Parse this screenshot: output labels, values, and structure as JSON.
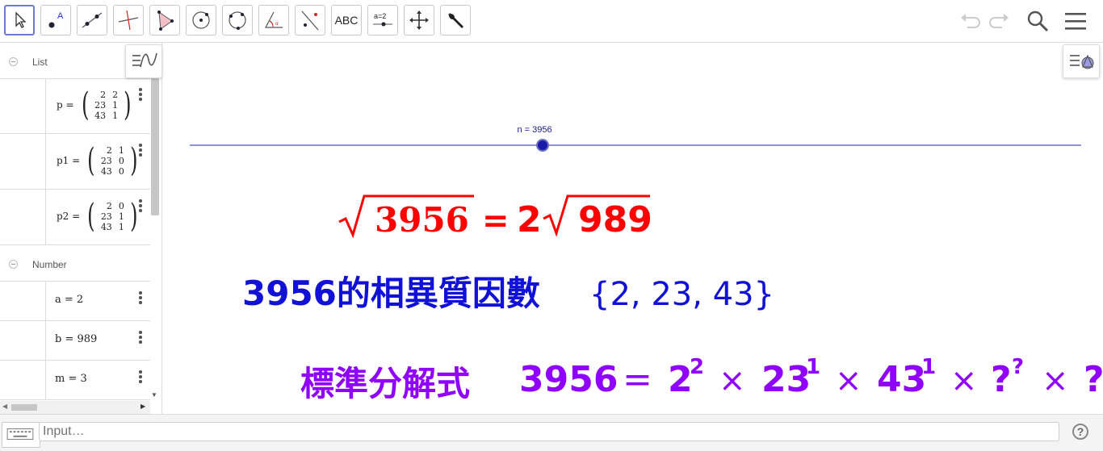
{
  "toolbar": {
    "tools": [
      {
        "id": "move",
        "active": true
      },
      {
        "id": "point"
      },
      {
        "id": "line"
      },
      {
        "id": "perpendicular-line"
      },
      {
        "id": "polygon"
      },
      {
        "id": "circle-center-point"
      },
      {
        "id": "circle-three-points"
      },
      {
        "id": "angle"
      },
      {
        "id": "reflect"
      },
      {
        "id": "text",
        "label": "ABC"
      },
      {
        "id": "slider",
        "label": "a=2"
      },
      {
        "id": "move-graphics-view"
      },
      {
        "id": "tools-wrench"
      }
    ],
    "right": [
      "undo-icon",
      "redo-icon",
      "search-icon",
      "menu-icon"
    ]
  },
  "algebra": {
    "list_group": "List",
    "number_group": "Number",
    "matrices": [
      {
        "name": "p",
        "rows": [
          [
            "2",
            "2"
          ],
          [
            "23",
            "1"
          ],
          [
            "43",
            "1"
          ]
        ]
      },
      {
        "name": "p1",
        "rows": [
          [
            "2",
            "1"
          ],
          [
            "23",
            "0"
          ],
          [
            "43",
            "0"
          ]
        ]
      },
      {
        "name": "p2",
        "rows": [
          [
            "2",
            "0"
          ],
          [
            "23",
            "1"
          ],
          [
            "43",
            "1"
          ]
        ]
      }
    ],
    "numbers": [
      "a = 2",
      "b = 989",
      "m = 3"
    ]
  },
  "graphics": {
    "slider_label": "n = 3956",
    "slider_value": 3956,
    "line1": {
      "radicand": "3956",
      "eq": "=",
      "coef": "2",
      "radicand2": "989"
    },
    "line2": {
      "text": "3956的相異質因數",
      "set": "{2, 23, 43}"
    },
    "line3": {
      "label": "標準分解式",
      "n": "3956",
      "eq": "=",
      "factors": [
        {
          "base": "2",
          "exp": "2"
        },
        {
          "base": "23",
          "exp": "1"
        },
        {
          "base": "43",
          "exp": "1"
        },
        {
          "base": "?",
          "exp": "?"
        },
        {
          "base": "?",
          "exp": ""
        }
      ],
      "times": "×"
    },
    "colors": {
      "red": "#ff0000",
      "blue": "#1010d8",
      "purple": "#8f00ff",
      "slider": "#8f90e0",
      "point": "#0000a0"
    }
  },
  "input": {
    "placeholder": "Input…"
  },
  "help_label": "?"
}
